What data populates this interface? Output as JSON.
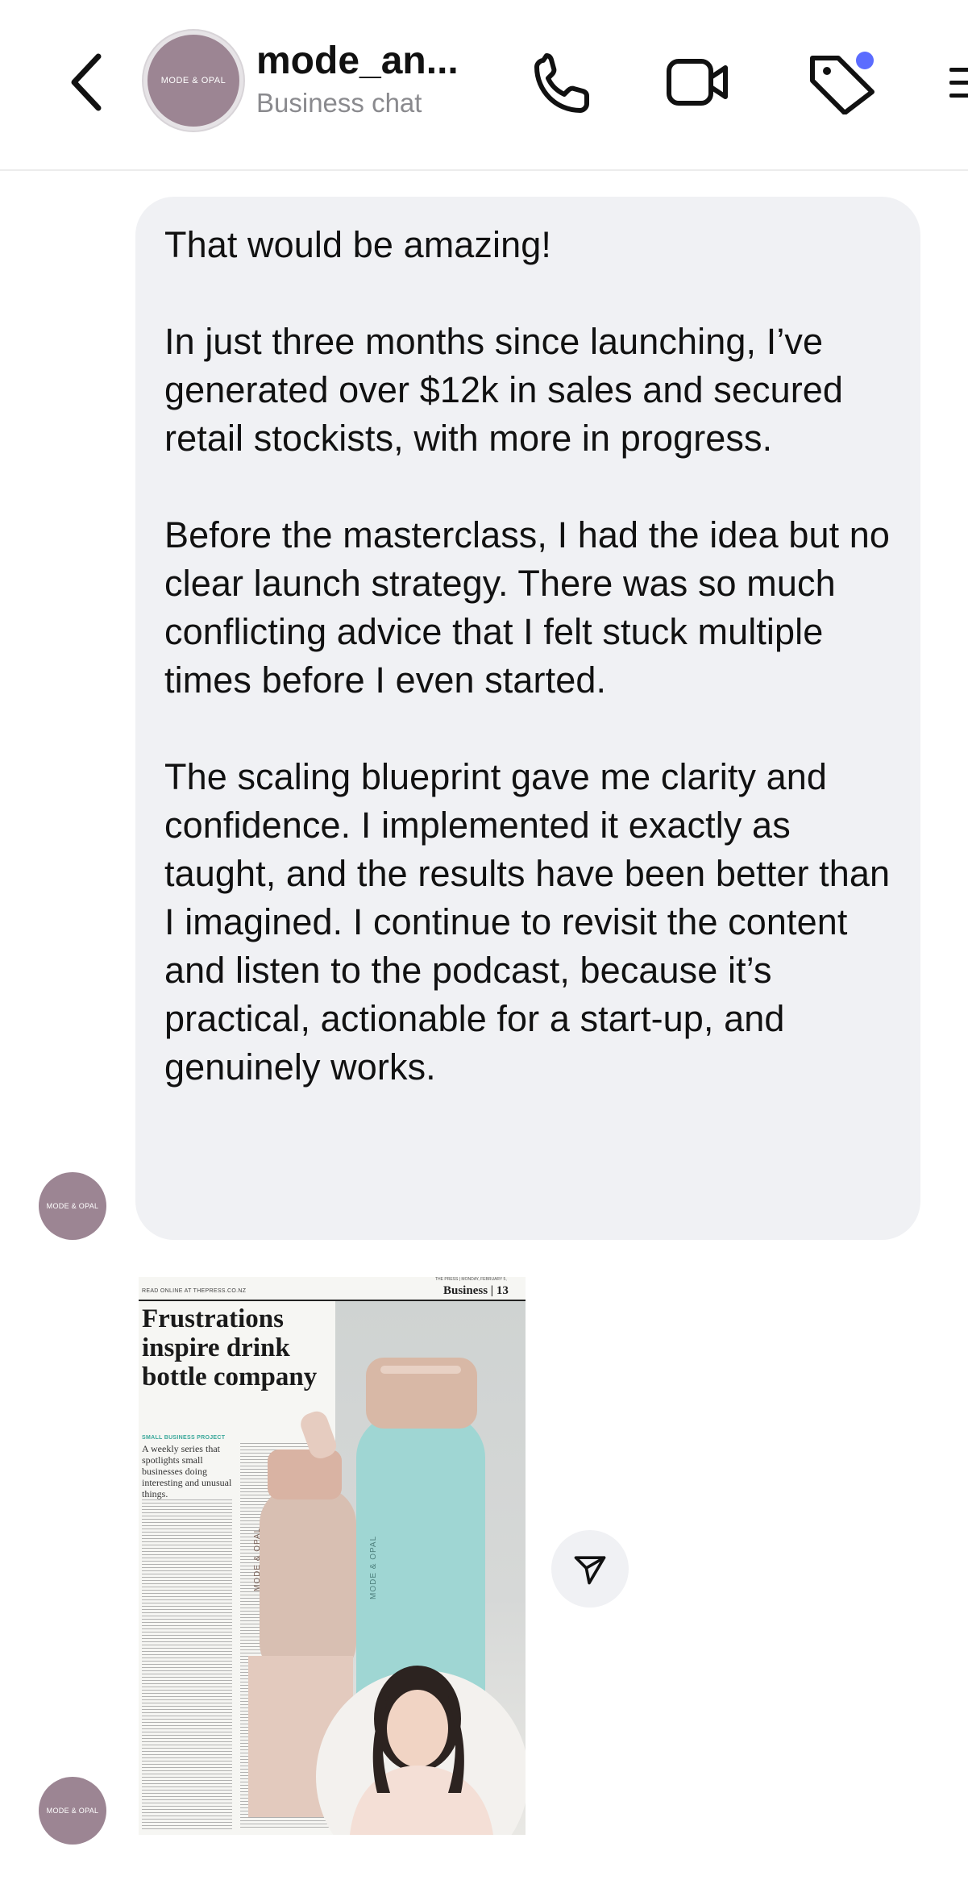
{
  "header": {
    "avatar_text": "MODE & OPAL",
    "title": "mode_an...",
    "subtitle": "Business chat"
  },
  "message": {
    "paragraphs": [
      "That would be amazing!",
      "In just three months since launching, I’ve generated over $12k in sales and secured retail stockists, with more in progress.",
      "Before the masterclass, I had the idea but no clear launch strategy. There was so much conflicting advice that I felt stuck multiple times before I even started.",
      "The scaling blueprint gave me clarity and confidence. I implemented it exactly as taught, and the results have been better than I imagined. I continue to revisit the content and listen to the podcast, because it’s practical, actionable for a start-up, and genuinely works."
    ],
    "sender_avatar_text": "MODE & OPAL"
  },
  "attachment": {
    "masthead_left": "READ ONLINE AT THEPRESS.CO.NZ",
    "masthead_top": "THE PRESS | MONDAY, FEBRUARY 5,",
    "masthead_right": "Business | 13",
    "headline": "Frustrations inspire drink bottle company",
    "kicker": "SMALL BUSINESS PROJECT",
    "standfirst": "A weekly series that spotlights small businesses doing interesting and unusual things.",
    "bottle_brand": "MODE & OPAL",
    "sender_avatar_text": "MODE & OPAL"
  },
  "icons": {
    "back": "chevron-left-icon",
    "phone": "phone-icon",
    "video": "video-camera-icon",
    "tag": "tag-icon",
    "menu": "menu-icon",
    "share": "send-icon"
  },
  "colors": {
    "bubble": "#f0f1f4",
    "avatar": "#9c8593",
    "notification_dot": "#5b6cff",
    "subtitle": "#8a8a8e"
  }
}
